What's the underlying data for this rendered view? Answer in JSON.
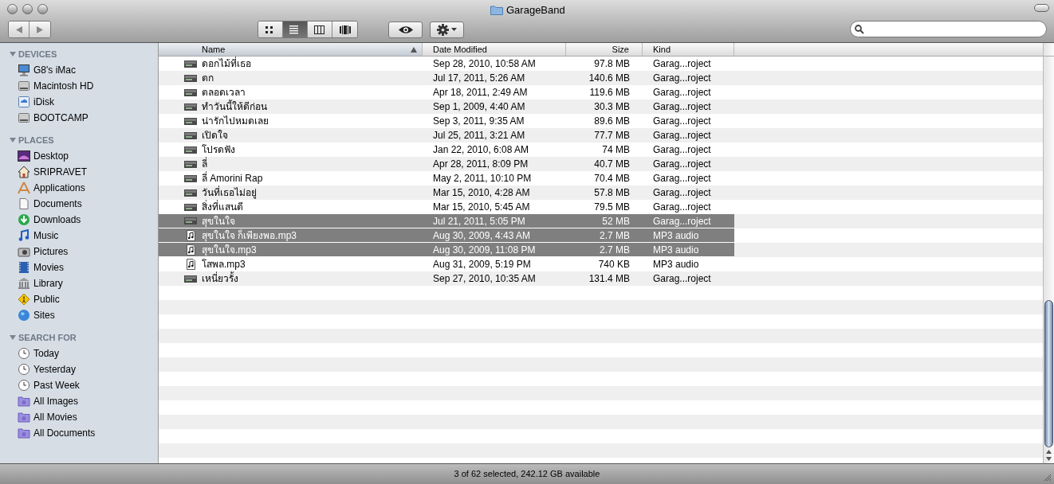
{
  "window": {
    "title": "GarageBand"
  },
  "toolbar": {
    "view_buttons": [
      {
        "kind": "icons",
        "selected": false
      },
      {
        "kind": "list",
        "selected": true
      },
      {
        "kind": "columns",
        "selected": false
      },
      {
        "kind": "coverflow",
        "selected": false
      }
    ]
  },
  "sidebar": {
    "sections": [
      {
        "title": "DEVICES",
        "expanded": true,
        "items": [
          {
            "label": "G8's iMac",
            "kind": "computer"
          },
          {
            "label": "Macintosh HD",
            "kind": "drive"
          },
          {
            "label": "iDisk",
            "kind": "idisk"
          },
          {
            "label": "BOOTCAMP",
            "kind": "drive"
          }
        ]
      },
      {
        "title": "PLACES",
        "expanded": true,
        "items": [
          {
            "label": "Desktop",
            "kind": "desktop"
          },
          {
            "label": "SRIPRAVET",
            "kind": "home"
          },
          {
            "label": "Applications",
            "kind": "apps"
          },
          {
            "label": "Documents",
            "kind": "document"
          },
          {
            "label": "Downloads",
            "kind": "download"
          },
          {
            "label": "Music",
            "kind": "music"
          },
          {
            "label": "Pictures",
            "kind": "camera"
          },
          {
            "label": "Movies",
            "kind": "film"
          },
          {
            "label": "Library",
            "kind": "library"
          },
          {
            "label": "Public",
            "kind": "public"
          },
          {
            "label": "Sites",
            "kind": "globe"
          }
        ]
      },
      {
        "title": "SEARCH FOR",
        "expanded": true,
        "items": [
          {
            "label": "Today",
            "kind": "clock"
          },
          {
            "label": "Yesterday",
            "kind": "clock"
          },
          {
            "label": "Past Week",
            "kind": "clock"
          },
          {
            "label": "All Images",
            "kind": "smart"
          },
          {
            "label": "All Movies",
            "kind": "smart"
          },
          {
            "label": "All Documents",
            "kind": "smart"
          }
        ]
      }
    ]
  },
  "table": {
    "columns": [
      "Name",
      "Date Modified",
      "Size",
      "Kind"
    ],
    "rows": [
      {
        "name": "ดอกไม้ที่เธอ",
        "date": "Sep 28, 2010, 10:58 AM",
        "size": "97.8 MB",
        "kind_text": "Garag...roject",
        "kind": "project",
        "selected": false
      },
      {
        "name": "ตก",
        "date": "Jul 17, 2011, 5:26 AM",
        "size": "140.6 MB",
        "kind_text": "Garag...roject",
        "kind": "project",
        "selected": false
      },
      {
        "name": "ตลอดเวลา",
        "date": "Apr 18, 2011, 2:49 AM",
        "size": "119.6 MB",
        "kind_text": "Garag...roject",
        "kind": "project",
        "selected": false
      },
      {
        "name": "ทำวันนี้ให้ดีก่อน",
        "date": "Sep 1, 2009, 4:40 AM",
        "size": "30.3 MB",
        "kind_text": "Garag...roject",
        "kind": "project",
        "selected": false
      },
      {
        "name": "น่ารักไปหมดเลย",
        "date": "Sep 3, 2011, 9:35 AM",
        "size": "89.6 MB",
        "kind_text": "Garag...roject",
        "kind": "project",
        "selected": false
      },
      {
        "name": "เปิดใจ",
        "date": "Jul 25, 2011, 3:21 AM",
        "size": "77.7 MB",
        "kind_text": "Garag...roject",
        "kind": "project",
        "selected": false
      },
      {
        "name": "โปรดฟัง",
        "date": "Jan 22, 2010, 6:08 AM",
        "size": "74 MB",
        "kind_text": "Garag...roject",
        "kind": "project",
        "selected": false
      },
      {
        "name": "ลี่",
        "date": "Apr 28, 2011, 8:09 PM",
        "size": "40.7 MB",
        "kind_text": "Garag...roject",
        "kind": "project",
        "selected": false
      },
      {
        "name": "ลี่ Amorini Rap",
        "date": "May 2, 2011, 10:10 PM",
        "size": "70.4 MB",
        "kind_text": "Garag...roject",
        "kind": "project",
        "selected": false
      },
      {
        "name": "วันที่เธอไม่อยู่",
        "date": "Mar 15, 2010, 4:28 AM",
        "size": "57.8 MB",
        "kind_text": "Garag...roject",
        "kind": "project",
        "selected": false
      },
      {
        "name": "สิ่งที่แสนดี",
        "date": "Mar 15, 2010, 5:45 AM",
        "size": "79.5 MB",
        "kind_text": "Garag...roject",
        "kind": "project",
        "selected": false
      },
      {
        "name": "สุขในใจ",
        "date": "Jul 21, 2011, 5:05 PM",
        "size": "52 MB",
        "kind_text": "Garag...roject",
        "kind": "project",
        "selected": true
      },
      {
        "name": "สุขในใจ ก็เพียงพอ.mp3",
        "date": "Aug 30, 2009, 4:43 AM",
        "size": "2.7 MB",
        "kind_text": "MP3 audio",
        "kind": "audio",
        "selected": true
      },
      {
        "name": "สุขในใจ.mp3",
        "date": "Aug 30, 2009, 11:08 PM",
        "size": "2.7 MB",
        "kind_text": "MP3 audio",
        "kind": "audio",
        "selected": true
      },
      {
        "name": "โสพล.mp3",
        "date": "Aug 31, 2009, 5:19 PM",
        "size": "740 KB",
        "kind_text": "MP3 audio",
        "kind": "audio",
        "selected": false
      },
      {
        "name": "เหนี่ยวรั้ง",
        "date": "Sep 27, 2010, 10:35 AM",
        "size": "131.4 MB",
        "kind_text": "Garag...roject",
        "kind": "project",
        "selected": false
      }
    ]
  },
  "status_bar": "3 of 62 selected, 242.12 GB available"
}
